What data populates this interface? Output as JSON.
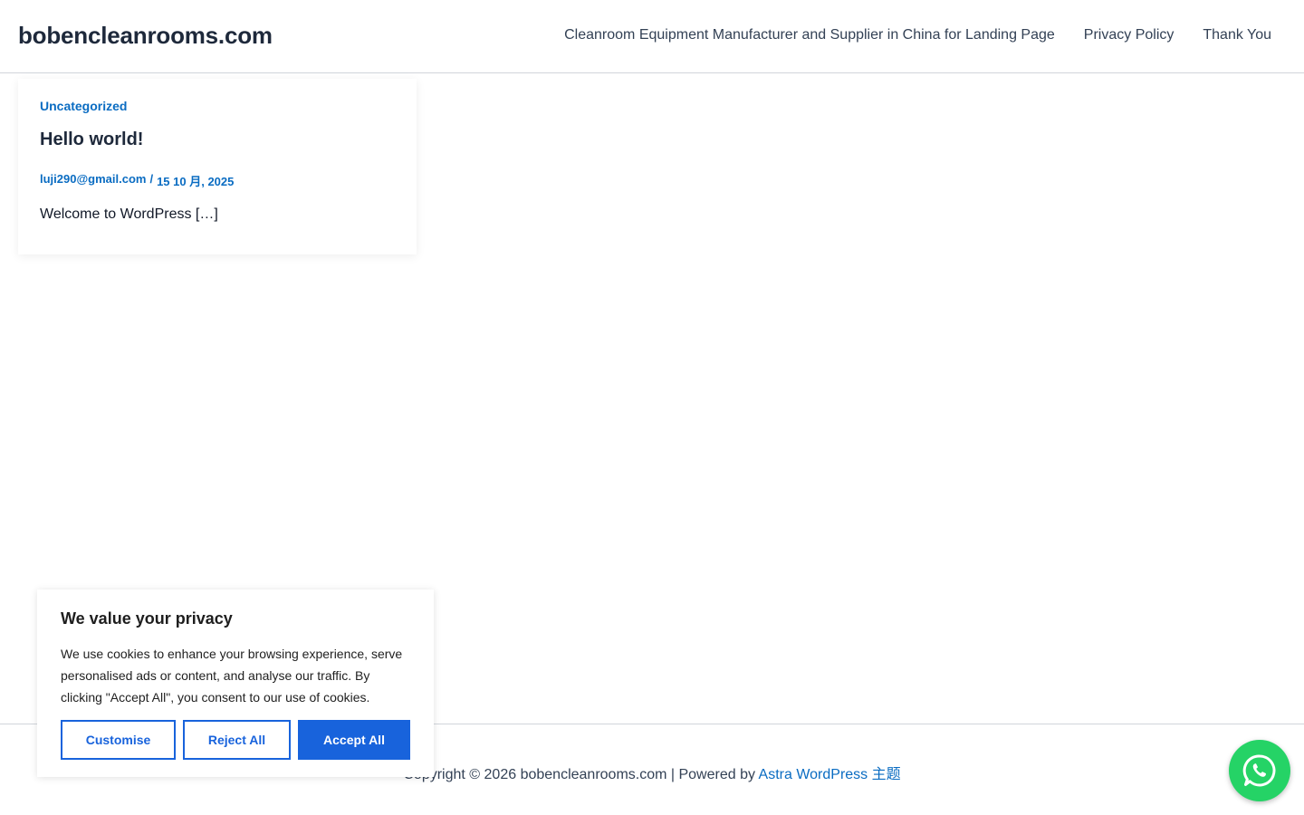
{
  "header": {
    "site_title": "bobencleanrooms.com",
    "nav": [
      "Cleanroom Equipment Manufacturer and Supplier in China for Landing Page",
      "Privacy Policy",
      "Thank You"
    ]
  },
  "post": {
    "category": "Uncategorized",
    "title": "Hello world!",
    "author": "luji290@gmail.com",
    "separator": "/",
    "date": "15 10 月, 2025",
    "excerpt": "Welcome to WordPress […]"
  },
  "footer": {
    "copyright": "Copyright © 2026 bobencleanrooms.com | Powered by",
    "link_text": "Astra WordPress 主题"
  },
  "cookie_banner": {
    "title": "We value your privacy",
    "body": "We use cookies to enhance your browsing experience, serve personalised ads or content, and analyse our traffic. By clicking \"Accept All\", you consent to our use of cookies.",
    "customise_label": "Customise",
    "reject_label": "Reject All",
    "accept_label": "Accept All"
  },
  "colors": {
    "accent": "#0a6cc2",
    "cookie_button": "#1863dc",
    "whatsapp": "#25d366"
  },
  "icons": {
    "floating_button": "whatsapp-icon"
  }
}
